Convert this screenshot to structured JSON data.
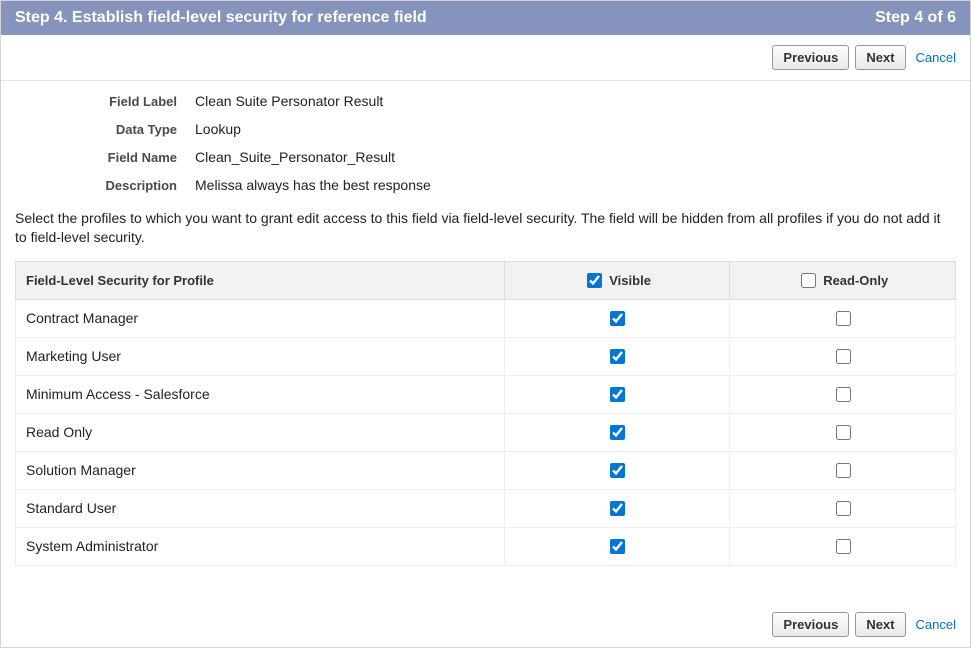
{
  "header": {
    "title": "Step 4. Establish field-level security for reference field",
    "progress": "Step 4 of 6"
  },
  "buttons": {
    "previous": "Previous",
    "next": "Next",
    "cancel": "Cancel"
  },
  "details": {
    "field_label_key": "Field Label",
    "field_label_val": "Clean Suite Personator Result",
    "data_type_key": "Data Type",
    "data_type_val": "Lookup",
    "field_name_key": "Field Name",
    "field_name_val": "Clean_Suite_Personator_Result",
    "description_key": "Description",
    "description_val": "Melissa always has the best response"
  },
  "instruction": "Select the profiles to which you want to grant edit access to this field via field-level security. The field will be hidden from all profiles if you do not add it to field-level security.",
  "table": {
    "col_profile": "Field-Level Security for Profile",
    "col_visible": "Visible",
    "col_readonly": "Read-Only",
    "header_visible_checked": true,
    "header_readonly_checked": false,
    "rows": [
      {
        "profile": "Contract Manager",
        "visible": true,
        "readonly": false
      },
      {
        "profile": "Marketing User",
        "visible": true,
        "readonly": false
      },
      {
        "profile": "Minimum Access - Salesforce",
        "visible": true,
        "readonly": false
      },
      {
        "profile": "Read Only",
        "visible": true,
        "readonly": false
      },
      {
        "profile": "Solution Manager",
        "visible": true,
        "readonly": false
      },
      {
        "profile": "Standard User",
        "visible": true,
        "readonly": false
      },
      {
        "profile": "System Administrator",
        "visible": true,
        "readonly": false
      }
    ]
  }
}
